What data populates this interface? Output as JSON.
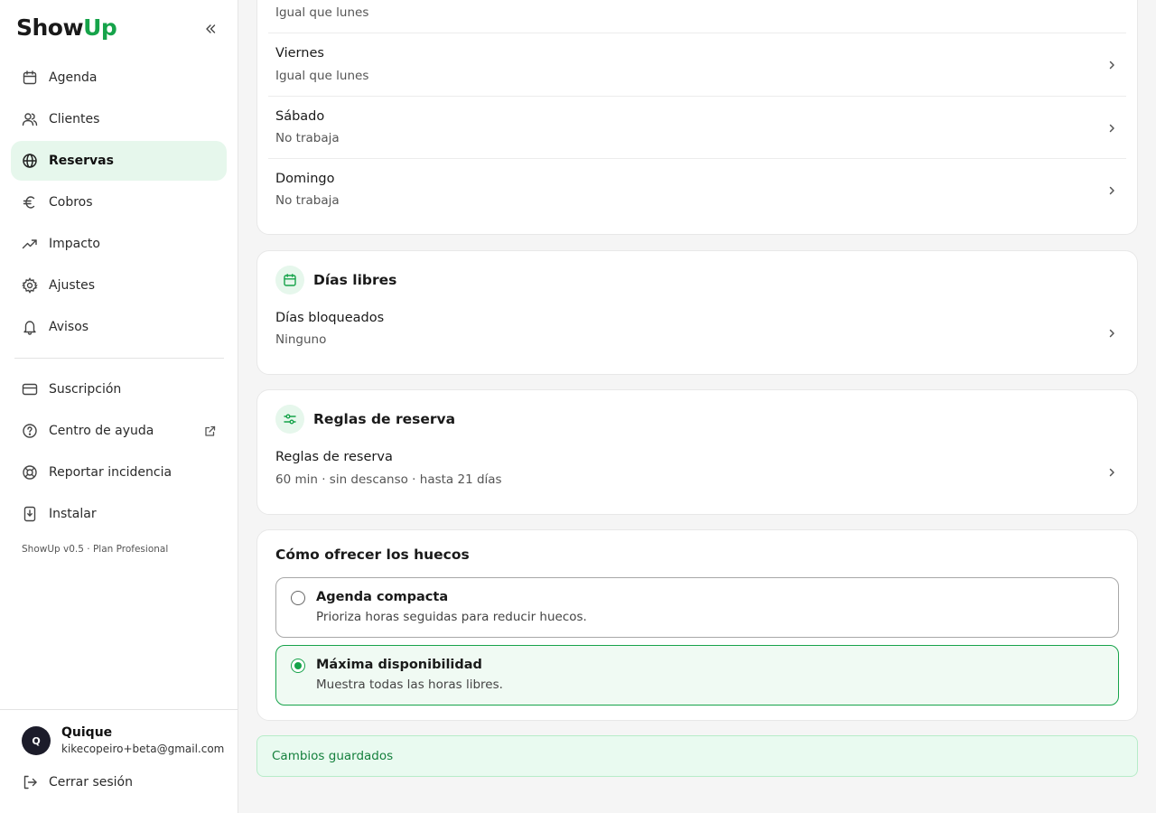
{
  "brand": {
    "part1": "Show",
    "part2": "Up"
  },
  "sidebar": {
    "items": [
      {
        "label": "Agenda",
        "icon": "calendar-icon"
      },
      {
        "label": "Clientes",
        "icon": "users-icon"
      },
      {
        "label": "Reservas",
        "icon": "globe-icon",
        "active": true
      },
      {
        "label": "Cobros",
        "icon": "euro-icon"
      },
      {
        "label": "Impacto",
        "icon": "trending-up-icon"
      },
      {
        "label": "Ajustes",
        "icon": "gear-icon"
      },
      {
        "label": "Avisos",
        "icon": "bell-icon"
      }
    ],
    "secondary": [
      {
        "label": "Suscripción",
        "icon": "credit-card-icon"
      },
      {
        "label": "Centro de ayuda",
        "icon": "help-circle-icon"
      },
      {
        "label": "Reportar incidencia",
        "icon": "lifebuoy-icon"
      },
      {
        "label": "Instalar",
        "icon": "install-icon"
      }
    ],
    "version": "ShowUp v0.5 · Plan Profesional",
    "user": {
      "initial": "Q",
      "name": "Quique",
      "email": "kikecopeiro+beta@gmail.com"
    },
    "logout": "Cerrar sesión"
  },
  "schedule": {
    "days": [
      {
        "day": "",
        "status": "Igual que lunes"
      },
      {
        "day": "Viernes",
        "status": "Igual que lunes"
      },
      {
        "day": "Sábado",
        "status": "No trabaja"
      },
      {
        "day": "Domingo",
        "status": "No trabaja"
      }
    ]
  },
  "days_off": {
    "title": "Días libres",
    "row": {
      "title": "Días bloqueados",
      "value": "Ninguno"
    }
  },
  "booking_rules": {
    "title": "Reglas de reserva",
    "row": {
      "title": "Reglas de reserva",
      "value": "60 min · sin descanso · hasta 21 días"
    }
  },
  "slots": {
    "title": "Cómo ofrecer los huecos",
    "options": [
      {
        "title": "Agenda compacta",
        "description": "Prioriza horas seguidas para reducir huecos.",
        "selected": false
      },
      {
        "title": "Máxima disponibilidad",
        "description": "Muestra todas las horas libres.",
        "selected": true
      }
    ]
  },
  "toast": "Cambios guardados",
  "colors": {
    "accent": "#16a34a",
    "accent_bg": "#e6f7ec",
    "toast_bg": "#e9faf0"
  }
}
